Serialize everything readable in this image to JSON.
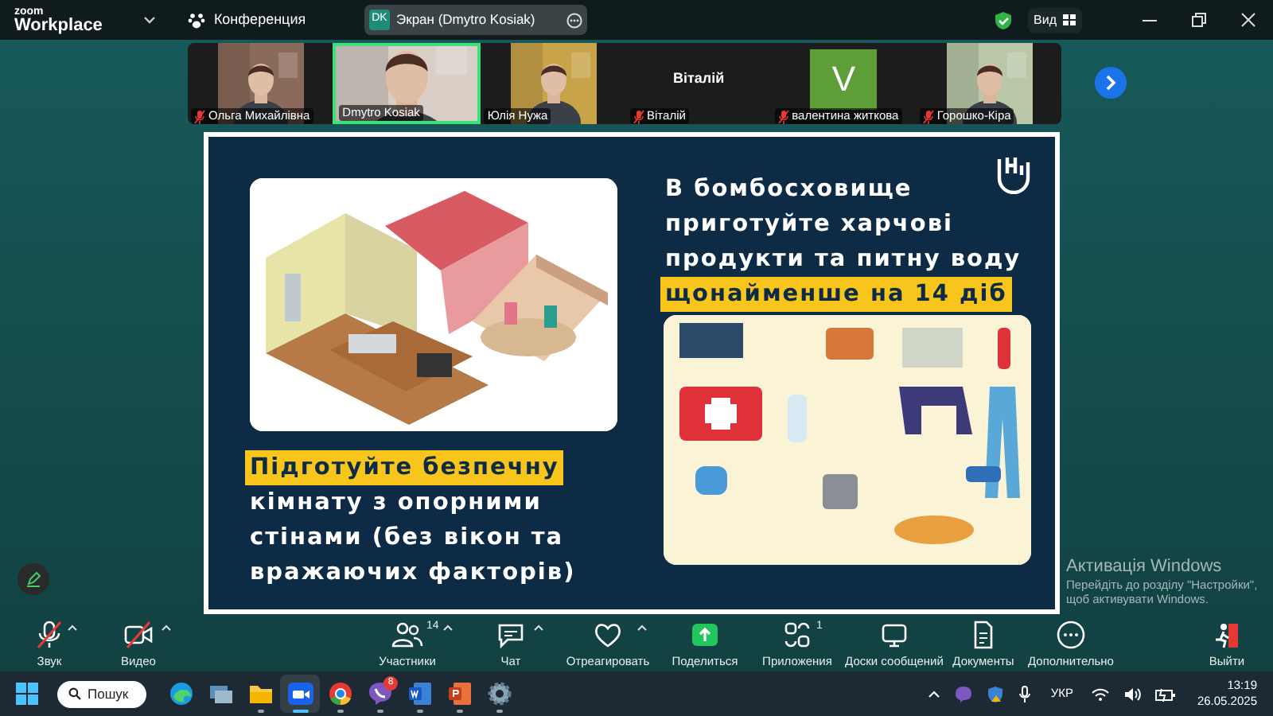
{
  "app": {
    "logo_top": "zoom",
    "logo_bottom": "Workplace",
    "meeting_label": "Конференция"
  },
  "share_pill": {
    "initials": "DK",
    "label": "Экран (Dmytro Kosiak)"
  },
  "view_button": {
    "label": "Вид"
  },
  "participants": [
    {
      "kind": "video",
      "name": "Ольга Михайлівна",
      "muted": true,
      "selected": false,
      "color": "#8a6a5a"
    },
    {
      "kind": "video",
      "name": "Dmytro Kosiak",
      "muted": false,
      "selected": true,
      "color": "#d9cfc6"
    },
    {
      "kind": "video",
      "name": "Юлія Нужа",
      "muted": false,
      "selected": false,
      "color": "#c9a34a"
    },
    {
      "kind": "name",
      "name": "Віталій",
      "display": "Віталій",
      "muted": true,
      "selected": false
    },
    {
      "kind": "avatar",
      "name": "валентина житкова",
      "letter": "V",
      "muted": true,
      "selected": false,
      "color": "#5e9e38"
    },
    {
      "kind": "video",
      "name": "Горошко-Кіра",
      "muted": true,
      "selected": false,
      "color": "#b9c9a8"
    }
  ],
  "slide": {
    "title_lines": [
      {
        "text": "В бомбосховище",
        "highlighted": false
      },
      {
        "text": "приготуйте харчові",
        "highlighted": false
      },
      {
        "text": "продукти та питну воду",
        "highlighted": false
      },
      {
        "text": "щонайменше на 14 діб",
        "highlighted": true
      }
    ],
    "room_lines": [
      {
        "text": "Підготуйте безпечну",
        "highlighted": true
      },
      {
        "text": "кімнату з опорними",
        "highlighted": false
      },
      {
        "text": "стінами (без вікон та",
        "highlighted": false
      },
      {
        "text": "вражаючих факторів)",
        "highlighted": false
      }
    ]
  },
  "watermark": {
    "title": "Активація Windows",
    "text": "Перейдіть до розділу \"Настройки\", щоб активувати Windows."
  },
  "toolbar": [
    {
      "kind": "audio",
      "label": "Звук",
      "muted": true,
      "caret": true
    },
    {
      "kind": "video",
      "label": "Видео",
      "muted": true,
      "caret": true
    },
    {
      "kind": "participants",
      "label": "Участники",
      "count": "14",
      "caret": true
    },
    {
      "kind": "chat",
      "label": "Чат",
      "caret": true
    },
    {
      "kind": "react",
      "label": "Отреагировать",
      "caret": true
    },
    {
      "kind": "share",
      "label": "Поделиться",
      "caret": false
    },
    {
      "kind": "apps",
      "label": "Приложения",
      "count": "1",
      "caret": false
    },
    {
      "kind": "boards",
      "label": "Доски сообщений",
      "caret": false
    },
    {
      "kind": "docs",
      "label": "Документы",
      "caret": false
    },
    {
      "kind": "more",
      "label": "Дополнительно",
      "caret": false
    },
    {
      "kind": "leave",
      "label": "Выйти",
      "caret": false
    }
  ],
  "taskbar": {
    "search": "Пошук",
    "apps": [
      {
        "kind": "edge",
        "open": false,
        "selected": false
      },
      {
        "kind": "tasks",
        "open": false,
        "selected": false
      },
      {
        "kind": "files",
        "open": true,
        "selected": false
      },
      {
        "kind": "zoom",
        "open": true,
        "selected": true
      },
      {
        "kind": "chrome",
        "open": true,
        "selected": false
      },
      {
        "kind": "viber",
        "open": true,
        "selected": false,
        "badge": "8"
      },
      {
        "kind": "word",
        "open": true,
        "selected": false
      },
      {
        "kind": "powerpoint",
        "open": true,
        "selected": false
      },
      {
        "kind": "settings",
        "open": true,
        "selected": false
      }
    ],
    "language": "УКР",
    "time": "13:19",
    "date": "26.05.2025"
  }
}
